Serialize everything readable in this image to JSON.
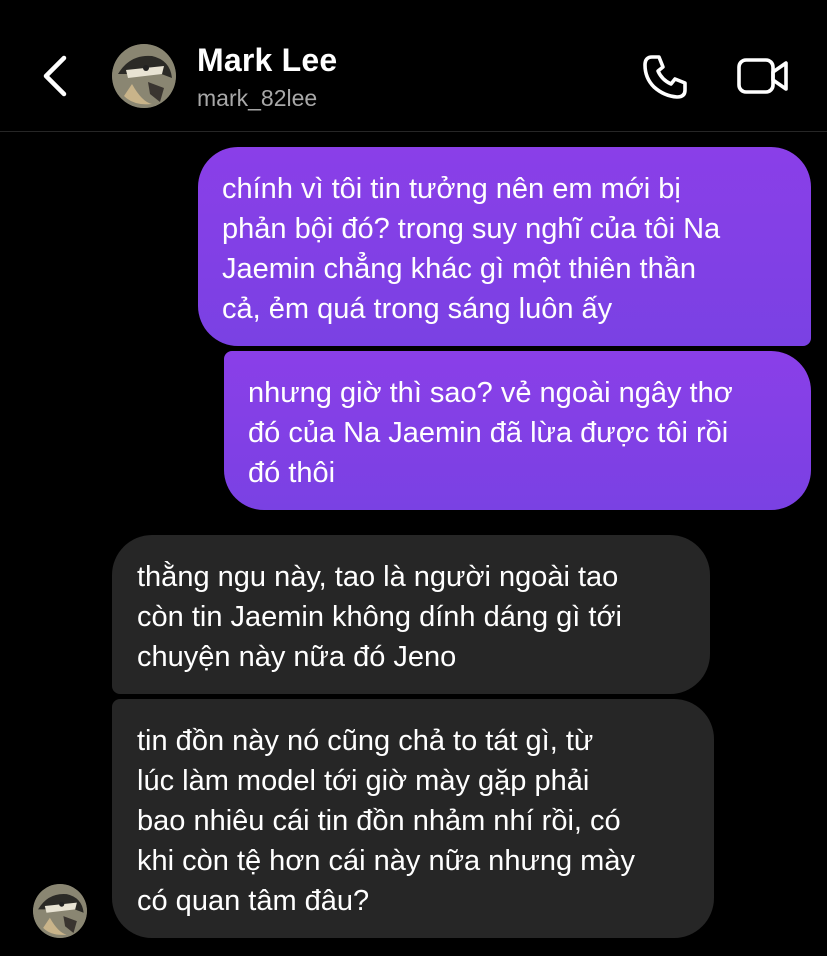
{
  "header": {
    "contact_name": "Mark Lee",
    "username": "mark_82lee",
    "back_icon": "chevron-left-icon",
    "call_icon": "phone-icon",
    "video_icon": "video-camera-icon"
  },
  "colors": {
    "background": "#000000",
    "sent_bubble": "#7c3fe6",
    "received_bubble": "#262626",
    "secondary_text": "#a8a8a8"
  },
  "messages": [
    {
      "direction": "sent",
      "text": "chính vì tôi tin tưởng nên em mới bị\nphản bội đó? trong suy nghĩ của tôi Na\nJaemin chẳng khác gì một thiên thần\ncả, ẻm quá trong sáng luôn ấy"
    },
    {
      "direction": "sent",
      "text": "nhưng giờ thì sao? vẻ ngoài ngây thơ\nđó của Na Jaemin đã lừa được tôi rồi\nđó thôi"
    },
    {
      "direction": "received",
      "text": "thằng ngu này, tao là người ngoài tao\ncòn tin Jaemin không dính dáng gì tới\nchuyện này nữa đó Jeno"
    },
    {
      "direction": "received",
      "text": "tin đồn này nó cũng chả to tát gì, từ\nlúc làm model tới giờ mày gặp phải\nbao nhiêu cái tin đồn nhảm nhí rồi, có\nkhi còn tệ hơn cái này nữa nhưng mày\ncó quan tâm đâu?"
    }
  ]
}
